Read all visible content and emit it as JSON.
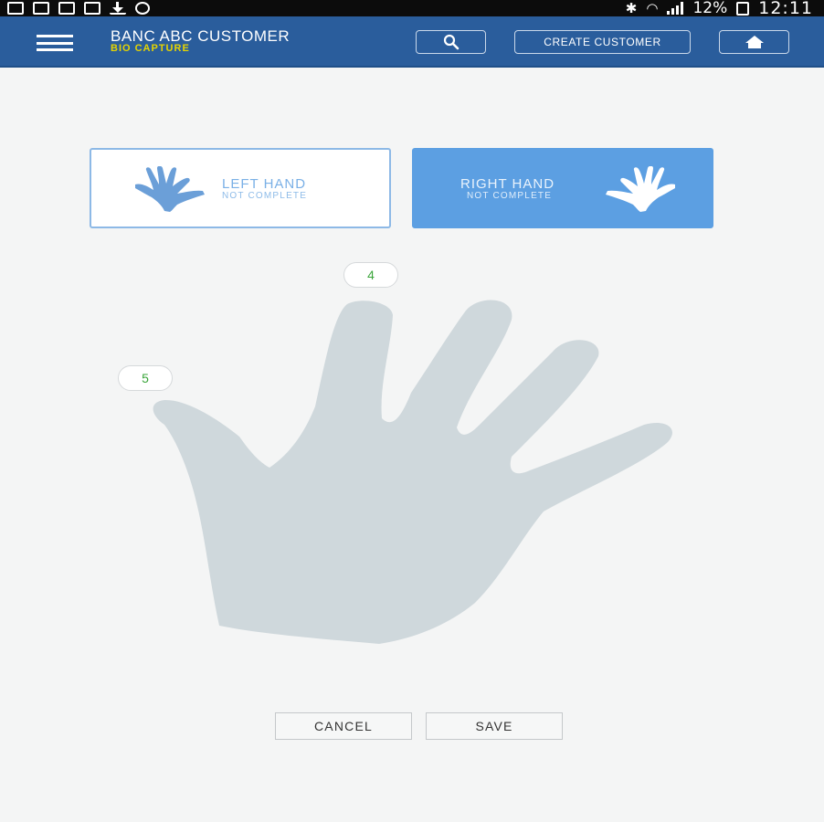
{
  "status_bar": {
    "battery": "12%",
    "time": "12:11"
  },
  "app_bar": {
    "title": "BANC ABC CUSTOMER",
    "subtitle": "BIO CAPTURE",
    "create_customer_label": "CREATE CUSTOMER",
    "search_icon": "search-icon",
    "home_icon": "home-icon",
    "menu_icon": "menu-icon"
  },
  "hand_tabs": [
    {
      "label": "LEFT HAND",
      "status": "NOT COMPLETE",
      "selected": false
    },
    {
      "label": "RIGHT HAND",
      "status": "NOT COMPLETE",
      "selected": true
    }
  ],
  "finger_badges": {
    "index": "4",
    "thumb": "5"
  },
  "actions": {
    "cancel_label": "CANCEL",
    "save_label": "SAVE"
  },
  "colors": {
    "app_bar": "#2a5d9c",
    "subtitle": "#e6d400",
    "selected_tab": "#5c9fe2",
    "hand_silhouette": "#cfd8dc",
    "badge_text": "#3aa53a"
  }
}
